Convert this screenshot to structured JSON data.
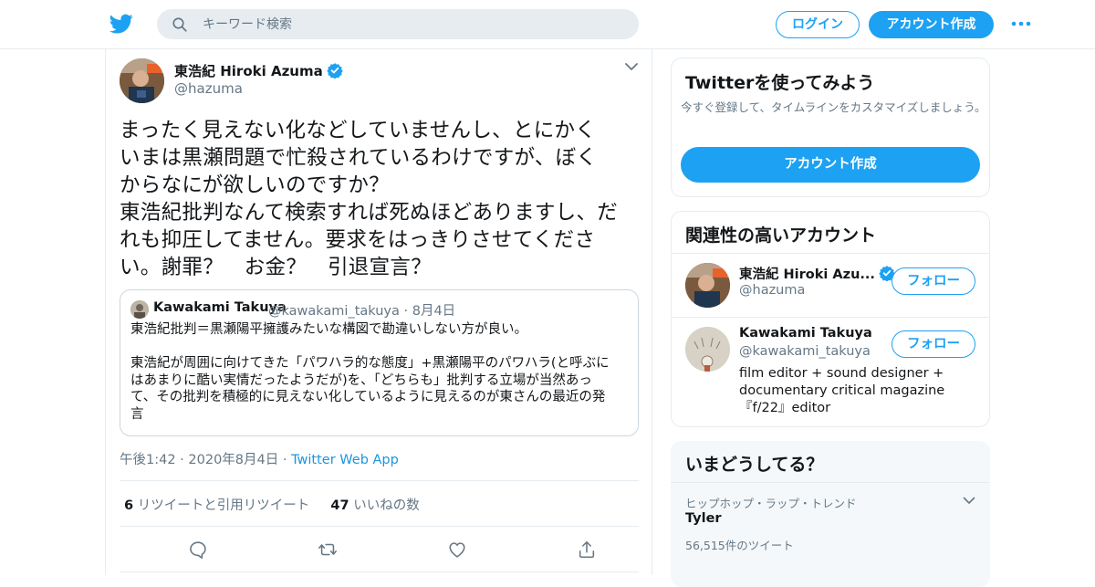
{
  "header": {
    "search_placeholder": "キーワード検索",
    "login_label": "ログイン",
    "signup_label": "アカウント作成",
    "accent_color": "#1da1f2"
  },
  "tweet": {
    "author_name": "東浩紀 Hiroki Azuma",
    "author_handle": "@hazuma",
    "text": "まったく見えない化などしていませんし、とにかく\nいまは黒瀬問題で忙殺されているわけですが、ぼく\nからなにが欲しいのですか？\n東浩紀批判なんて検索すれば死ぬほどありますし、だ\nれも抑圧してません。要求をはっきりさせてくださ\nい。謝罪？　お金？　引退宣言？",
    "quote": {
      "name": "Kawakami Takuya",
      "handle": "@kawakami_takuya",
      "date": "8月4日",
      "text": "東浩紀批判＝黒瀬陽平擁護みたいな構図で勘違いしない方が良い。\n\n東浩紀が周囲に向けてきた「パワハラ的な態度」+黒瀬陽平のパワハラ(と呼ぶに\nはあまりに酷い実情だったようだが)を、「どちらも」批判する立場が当然あっ\nて、その批判を積極的に見えない化しているように見えるのが東さんの最近の発\n言"
    },
    "time": "午後1:42",
    "date": "2020年8月4日",
    "via": "Twitter Web App",
    "retweet_count": "6",
    "retweet_label": "リツイートと引用リツイート",
    "like_count": "47",
    "like_label": "いいねの数"
  },
  "sidebar": {
    "try": {
      "title": "Twitterを使ってみよう",
      "subtitle": "今すぐ登録して、タイムラインをカスタマイズしましょう。",
      "button": "アカウント作成"
    },
    "related": {
      "title": "関連性の高いアカウント",
      "accounts": [
        {
          "name": "東浩紀 Hiroki Azu...",
          "handle": "@hazuma",
          "follow": "フォロー",
          "verified": true
        },
        {
          "name": "Kawakami Takuya",
          "handle": "@kawakami_takuya",
          "follow": "フォロー",
          "bio": "film editor + sound designer + documentary critical magazine『f/22』editor"
        }
      ]
    },
    "trends": {
      "title": "いまどうしてる？",
      "items": [
        {
          "category": "ヒップホップ・ラップ・トレンド",
          "name": "Tyler",
          "count": "56,515件のツイート"
        }
      ]
    }
  }
}
